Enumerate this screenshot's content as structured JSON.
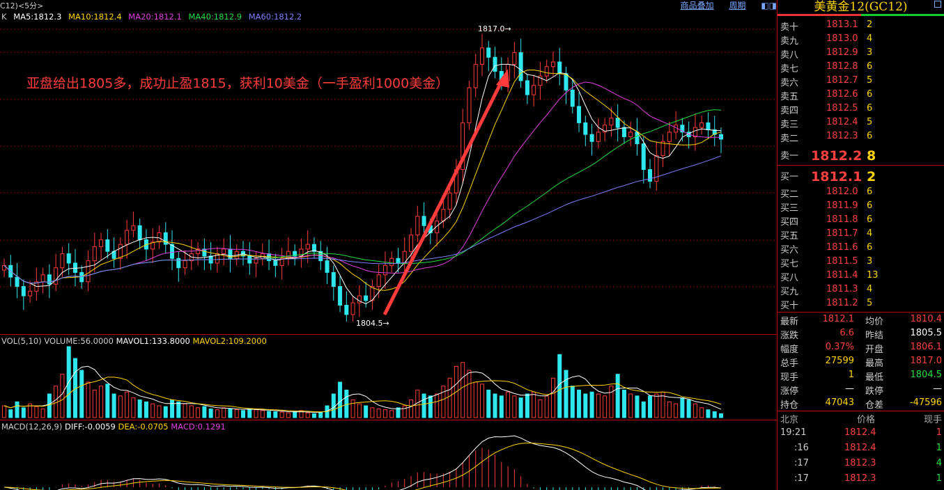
{
  "header": {
    "symbol_label": "C12)<5分>",
    "toolbar": [
      "商品叠加",
      "周期"
    ],
    "ma_prefix": "K",
    "ma": [
      {
        "label": "MA5:1812.3",
        "color": "#ffffff"
      },
      {
        "label": "MA10:1812.4",
        "color": "#ffd400"
      },
      {
        "label": "MA20:1812.1",
        "color": "#e040e0"
      },
      {
        "label": "MA40:1812.9",
        "color": "#22dd44"
      },
      {
        "label": "MA60:1812.2",
        "color": "#7f7fff"
      }
    ]
  },
  "annotation": "亚盘给出1805多，成功止盈1815，获利10美金（一手盈利1000美金）",
  "price_labels": {
    "high": "1817.0→",
    "low": "1804.5→"
  },
  "volume": {
    "label": "VOL(5,10)",
    "volume": "VOLUME:56.0000",
    "mavol1": "MAVOL1:133.8000",
    "mavol2": "MAVOL2:109.2000"
  },
  "macd": {
    "label": "MACD(12,26,9)",
    "diff": "DIFF:-0.0059",
    "dea": "DEA:-0.0705",
    "macd": "MACD:0.1291"
  },
  "colors": {
    "up": "#ff3b3b",
    "down": "#2ee8ee",
    "grid": "#8a0000"
  },
  "chart_data": {
    "type": "candlestick",
    "close_prices": [
      1806.9,
      1806.4,
      1806.0,
      1805.6,
      1805.8,
      1806.2,
      1806.5,
      1806.1,
      1806.8,
      1807.4,
      1807.0,
      1806.6,
      1806.2,
      1807.1,
      1807.7,
      1808.0,
      1807.5,
      1807.2,
      1807.8,
      1808.4,
      1808.6,
      1808.0,
      1807.6,
      1807.9,
      1808.3,
      1807.8,
      1807.2,
      1806.8,
      1807.1,
      1807.4,
      1807.6,
      1807.3,
      1807.0,
      1807.4,
      1807.6,
      1807.2,
      1807.5,
      1807.3,
      1807.0,
      1807.2,
      1807.4,
      1807.1,
      1806.9,
      1807.2,
      1807.5,
      1807.3,
      1807.6,
      1807.8,
      1807.5,
      1807.1,
      1806.6,
      1806.0,
      1805.2,
      1804.8,
      1805.3,
      1805.6,
      1805.4,
      1806.0,
      1806.5,
      1806.9,
      1807.2,
      1807.0,
      1807.5,
      1808.2,
      1809.0,
      1808.6,
      1808.3,
      1808.8,
      1809.3,
      1810.0,
      1811.0,
      1813.0,
      1814.5,
      1815.5,
      1816.2,
      1815.8,
      1815.2,
      1814.8,
      1815.5,
      1816.0,
      1814.8,
      1814.2,
      1814.6,
      1815.0,
      1815.4,
      1815.6,
      1815.1,
      1814.4,
      1813.7,
      1813.0,
      1812.5,
      1812.2,
      1812.6,
      1812.9,
      1813.2,
      1812.8,
      1812.4,
      1812.6,
      1812.1,
      1811.0,
      1810.5,
      1811.6,
      1812.2,
      1812.6,
      1812.9,
      1812.6,
      1812.4,
      1812.8,
      1813.0,
      1812.7,
      1812.5,
      1812.3
    ],
    "volume": [
      30,
      20,
      40,
      25,
      35,
      28,
      22,
      60,
      80,
      110,
      180,
      150,
      120,
      90,
      70,
      80,
      85,
      60,
      55,
      65,
      50,
      45,
      40,
      35,
      30,
      28,
      45,
      40,
      35,
      30,
      25,
      28,
      22,
      20,
      25,
      22,
      20,
      18,
      22,
      20,
      18,
      16,
      15,
      14,
      12,
      15,
      18,
      12,
      10,
      14,
      30,
      60,
      90,
      70,
      45,
      35,
      30,
      25,
      22,
      20,
      18,
      25,
      30,
      45,
      70,
      60,
      55,
      60,
      80,
      100,
      130,
      140,
      120,
      90,
      85,
      70,
      60,
      55,
      65,
      55,
      50,
      60,
      65,
      45,
      55,
      100,
      160,
      120,
      80,
      70,
      60,
      65,
      60,
      55,
      80,
      110,
      70,
      60,
      55,
      40,
      55,
      60,
      65,
      40,
      35,
      50,
      45,
      35,
      25,
      20,
      15,
      10
    ],
    "high": 1817.0,
    "low": 1804.5
  },
  "order_book": {
    "title": "美黄金12(GC12)",
    "sell": [
      {
        "label": "卖十",
        "price": "1813.1",
        "qty": "2"
      },
      {
        "label": "卖九",
        "price": "1813.0",
        "qty": "4"
      },
      {
        "label": "卖八",
        "price": "1812.9",
        "qty": "3"
      },
      {
        "label": "卖七",
        "price": "1812.8",
        "qty": "6"
      },
      {
        "label": "卖六",
        "price": "1812.7",
        "qty": "5"
      },
      {
        "label": "卖五",
        "price": "1812.6",
        "qty": "6"
      },
      {
        "label": "卖四",
        "price": "1812.5",
        "qty": "6"
      },
      {
        "label": "卖三",
        "price": "1812.4",
        "qty": "5"
      },
      {
        "label": "卖二",
        "price": "1812.3",
        "qty": "6"
      },
      {
        "label": "卖一",
        "price": "1812.2",
        "qty": "8"
      }
    ],
    "buy": [
      {
        "label": "买一",
        "price": "1812.1",
        "qty": "2"
      },
      {
        "label": "买二",
        "price": "1812.0",
        "qty": "6"
      },
      {
        "label": "买三",
        "price": "1811.9",
        "qty": "6"
      },
      {
        "label": "买四",
        "price": "1811.8",
        "qty": "6"
      },
      {
        "label": "买五",
        "price": "1811.7",
        "qty": "4"
      },
      {
        "label": "买六",
        "price": "1811.6",
        "qty": "6"
      },
      {
        "label": "买七",
        "price": "1811.5",
        "qty": "3"
      },
      {
        "label": "买八",
        "price": "1811.4",
        "qty": "13"
      },
      {
        "label": "买九",
        "price": "1811.3",
        "qty": "4"
      },
      {
        "label": "买十",
        "price": "1811.2",
        "qty": "5"
      }
    ]
  },
  "stats": [
    {
      "l1": "最新",
      "v1": "1812.1",
      "c1": "#ff4040",
      "l2": "均价",
      "v2": "1810.4",
      "c2": "#ff4040"
    },
    {
      "l1": "涨跌",
      "v1": "6.6",
      "c1": "#ff4040",
      "l2": "昨结",
      "v2": "1805.5",
      "c2": "#ffffff"
    },
    {
      "l1": "幅度",
      "v1": "0.37%",
      "c1": "#ff4040",
      "l2": "开盘",
      "v2": "1806.1",
      "c2": "#ff4040"
    },
    {
      "l1": "总手",
      "v1": "27599",
      "c1": "#ffd400",
      "l2": "最高",
      "v2": "1817.0",
      "c2": "#ff4040"
    },
    {
      "l1": "现手",
      "v1": "1",
      "c1": "#ffd400",
      "l2": "最低",
      "v2": "1804.5",
      "c2": "#22dd44"
    },
    {
      "l1": "涨停",
      "v1": "—",
      "c1": "#ffffff",
      "l2": "跌停",
      "v2": "—",
      "c2": "#ffffff"
    },
    {
      "l1": "持仓",
      "v1": "47043",
      "c1": "#ffd400",
      "l2": "仓差",
      "v2": "-47596",
      "c2": "#ffd400"
    }
  ],
  "ticks": {
    "head": {
      "time": "北京",
      "price": "价格",
      "qty": "现手"
    },
    "rows": [
      {
        "time": "19:21",
        "price": "1812.4",
        "qty": "1",
        "qcolor": "#ff4040"
      },
      {
        "time": ":16",
        "price": "1812.4",
        "qty": "1",
        "qcolor": "#22dd44"
      },
      {
        "time": ":17",
        "price": "1812.3",
        "qty": "4",
        "qcolor": "#22dd44"
      },
      {
        "time": ":17",
        "price": "1812.3",
        "qty": "1",
        "qcolor": "#22dd44"
      }
    ]
  }
}
